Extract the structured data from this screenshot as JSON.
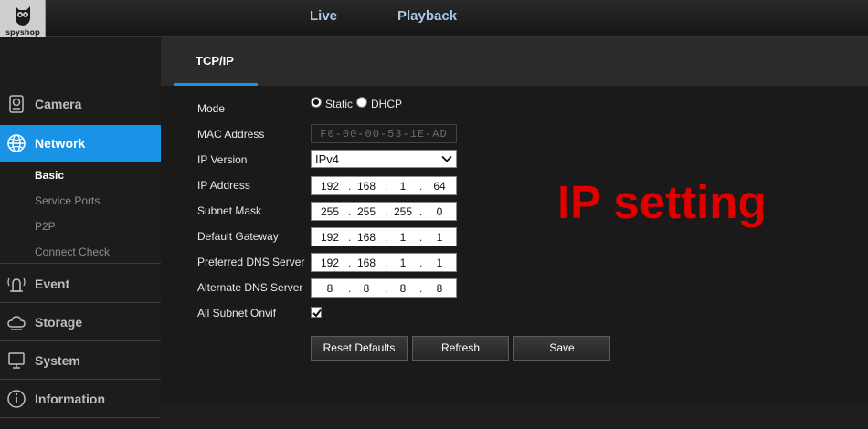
{
  "logo": {
    "brand": "spyshop"
  },
  "top_nav": {
    "live": "Live",
    "playback": "Playback"
  },
  "sidebar": {
    "camera": "Camera",
    "network": "Network",
    "network_sub": [
      "Basic",
      "Service Ports",
      "P2P",
      "Connect Check"
    ],
    "event": "Event",
    "storage": "Storage",
    "system": "System",
    "information": "Information"
  },
  "tabs": {
    "tcpip": "TCP/IP"
  },
  "form": {
    "mode": {
      "label": "Mode",
      "static": "Static",
      "dhcp": "DHCP",
      "selected": "Static"
    },
    "mac": {
      "label": "MAC Address",
      "value": "F0-00-00-53-1E-AD"
    },
    "ip_version": {
      "label": "IP Version",
      "value": "IPv4"
    },
    "ip_address": {
      "label": "IP Address",
      "octets": [
        "192",
        "168",
        "1",
        "64"
      ]
    },
    "subnet_mask": {
      "label": "Subnet Mask",
      "octets": [
        "255",
        "255",
        "255",
        "0"
      ]
    },
    "default_gateway": {
      "label": "Default Gateway",
      "octets": [
        "192",
        "168",
        "1",
        "1"
      ]
    },
    "preferred_dns": {
      "label": "Preferred DNS Server",
      "octets": [
        "192",
        "168",
        "1",
        "1"
      ]
    },
    "alternate_dns": {
      "label": "Alternate DNS Server",
      "octets": [
        "8",
        "8",
        "8",
        "8"
      ]
    },
    "all_subnet_onvif": {
      "label": "All Subnet Onvif",
      "checked": true
    }
  },
  "buttons": {
    "reset": "Reset Defaults",
    "refresh": "Refresh",
    "save": "Save"
  },
  "overlay": {
    "text": "IP setting",
    "color": "#e00000"
  },
  "colors": {
    "accent": "#1a93e6"
  }
}
